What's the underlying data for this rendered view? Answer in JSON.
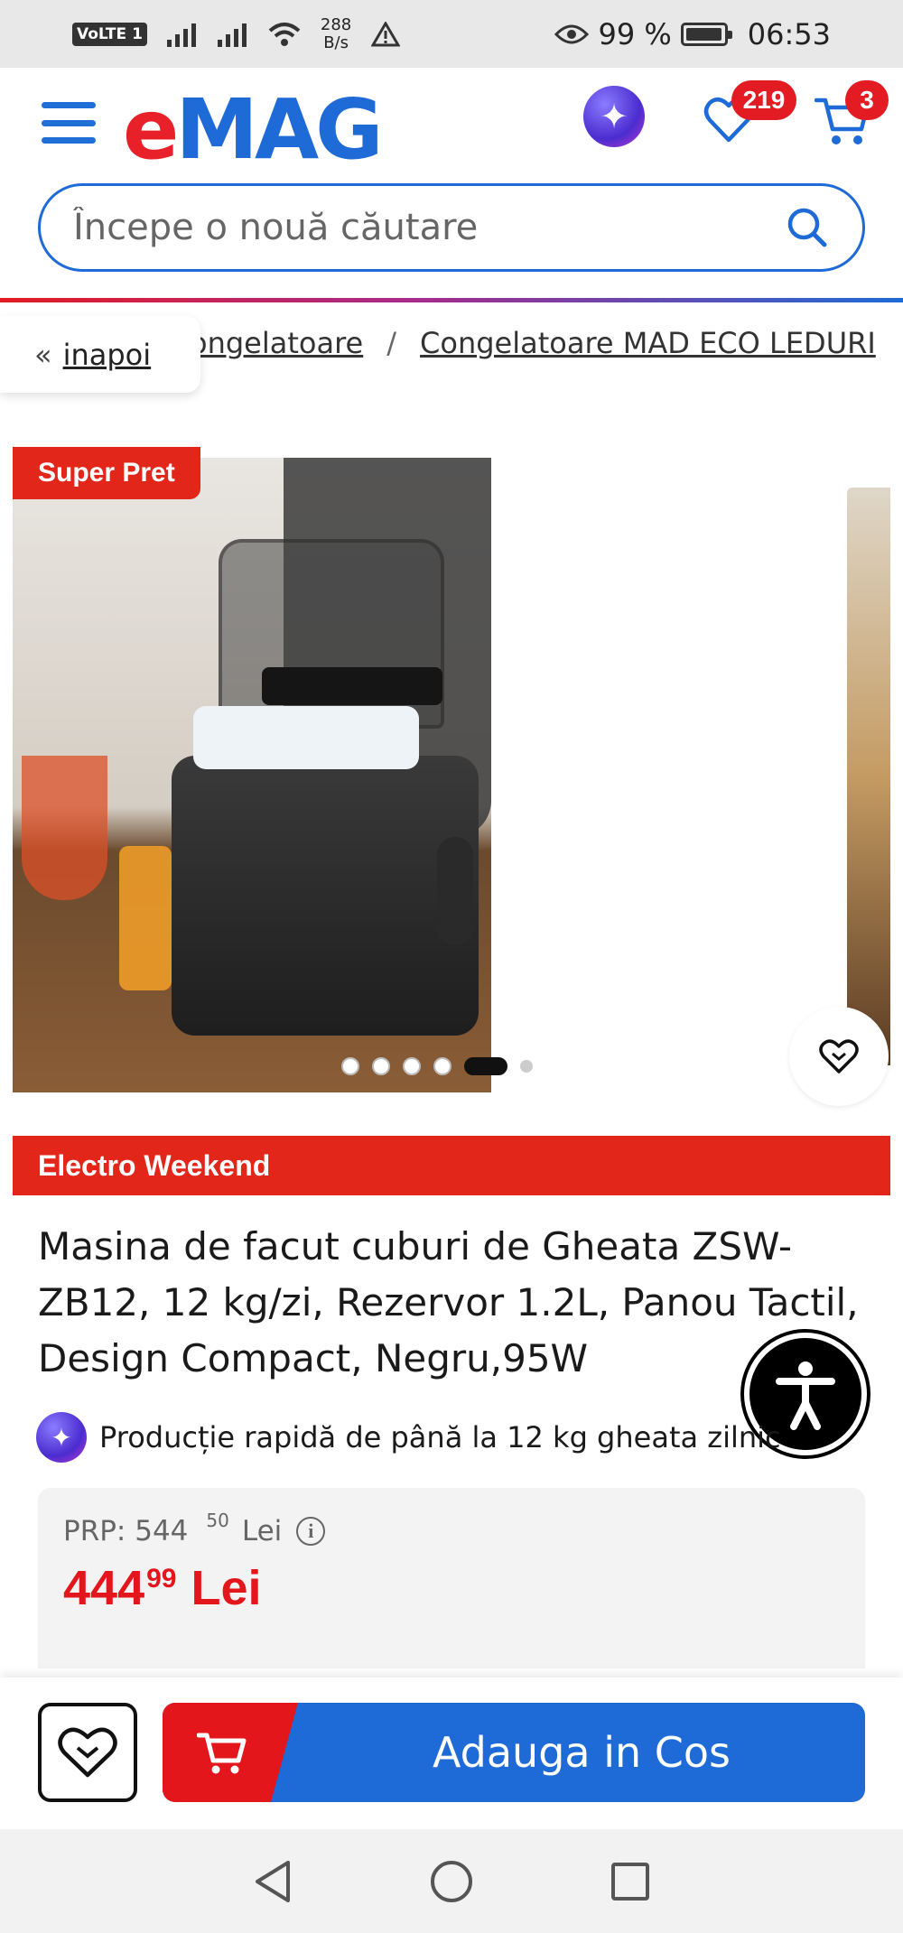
{
  "status_bar": {
    "volte": "VoLTE",
    "sim": "1",
    "net_speed_value": "288",
    "net_speed_unit": "B/s",
    "battery_percent": "99 %",
    "battery_level": 0.99,
    "time": "06:53"
  },
  "header": {
    "logo_e": "e",
    "logo_mag": "MAG",
    "favorites_count": "219",
    "cart_count": "3",
    "brand_red": "#e8202a",
    "brand_blue": "#1e6ad6"
  },
  "search": {
    "placeholder": "Începe o nouă căutare"
  },
  "breadcrumb": {
    "back_label": "inapoi",
    "back_chevron": "«",
    "items": [
      "ongelatoare",
      "Congelatoare MAD ECO LEDURI"
    ],
    "separator": "/"
  },
  "gallery": {
    "tag": "Super Pret",
    "dot_count": 6,
    "active_dot": 5
  },
  "promo": {
    "label": "Electro Weekend"
  },
  "product": {
    "title": "Masina de facut cuburi de Gheata ZSW-ZB12, 12 kg/zi, Rezervor 1.2L, Panou Tactil, Design Compact, Negru,95W",
    "feature": "Producție rapidă de până la 12 kg gheata zilnic"
  },
  "price": {
    "prp_label": "PRP: 544",
    "prp_cents": "50",
    "prp_currency": "Lei",
    "main": "444",
    "cents": "99",
    "currency": "Lei",
    "color": "#e3161c"
  },
  "actions": {
    "add_to_cart": "Adauga in Cos"
  },
  "icons": [
    "menu-icon",
    "ai-assistant-icon",
    "heart-icon",
    "cart-icon",
    "search-icon",
    "accessibility-icon",
    "info-icon",
    "back-icon",
    "home-icon",
    "recents-icon"
  ]
}
